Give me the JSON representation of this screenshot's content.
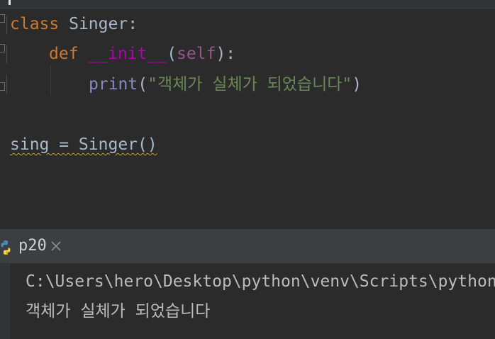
{
  "editor": {
    "line1": {
      "keyword": "class",
      "name": "Singer",
      "colon": ":"
    },
    "line2": {
      "keyword": "def",
      "name": "__init__",
      "open": "(",
      "param": "self",
      "close": "):"
    },
    "line3": {
      "builtin": "print",
      "open": "(",
      "string": "\"객체가 실체가 되었습니다\"",
      "close": ")"
    },
    "line5": {
      "text": "sing = Singer()"
    }
  },
  "run_panel": {
    "tab_label": "p20",
    "icons": {
      "tab": "python-icon",
      "close": "close-icon"
    }
  },
  "console": {
    "command": "C:\\Users\\hero\\Desktop\\python\\venv\\Scripts\\python",
    "output": "객체가 실체가 되었습니다"
  },
  "colors": {
    "background": "#2b2b2b",
    "keyword": "#cc7832",
    "magic_method": "#b200b2",
    "self": "#94558d",
    "builtin": "#8888c6",
    "string": "#6a8759",
    "text": "#a9b7c6"
  }
}
